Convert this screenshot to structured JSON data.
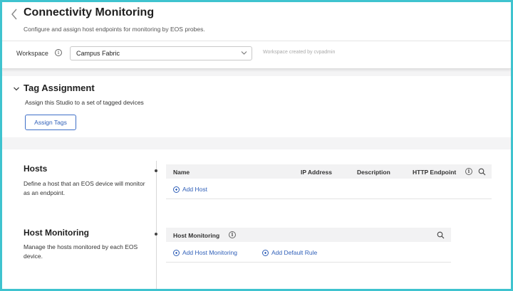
{
  "header": {
    "title": "Connectivity Monitoring",
    "subtitle": "Configure and assign host endpoints for monitoring by EOS probes.",
    "workspace_label": "Workspace",
    "workspace_value": "Campus Fabric",
    "workspace_created": "Workspace created by cvpadmin"
  },
  "tag_assignment": {
    "title": "Tag Assignment",
    "description": "Assign this Studio to a set of tagged devices",
    "button_label": "Assign Tags"
  },
  "hosts": {
    "title": "Hosts",
    "description": "Define a host that an EOS device will monitor as an endpoint.",
    "columns": [
      "Name",
      "IP Address",
      "Description",
      "HTTP Endpoint"
    ],
    "add_label": "Add Host"
  },
  "host_monitoring": {
    "title": "Host Monitoring",
    "description": "Manage the hosts monitored by each EOS device.",
    "column": "Host Monitoring",
    "add_label": "Add Host Monitoring",
    "default_rule_label": "Add Default Rule"
  },
  "colors": {
    "accent": "#2f5fb8",
    "border_frame": "#3fc3cf"
  }
}
